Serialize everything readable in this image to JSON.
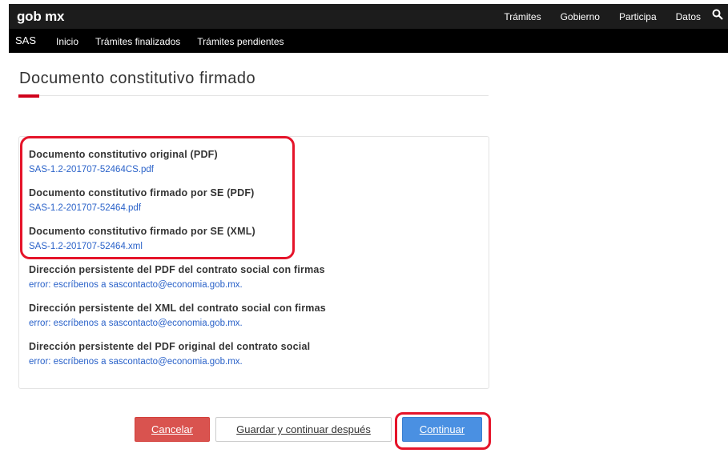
{
  "header": {
    "brand": "gob mx",
    "nav": [
      "Trámites",
      "Gobierno",
      "Participa",
      "Datos"
    ],
    "search_icon": "search-icon"
  },
  "subnav": {
    "app": "SAS",
    "items": [
      "Inicio",
      "Trámites finalizados",
      "Trámites pendientes"
    ]
  },
  "page": {
    "title": "Documento constitutivo firmado"
  },
  "documents": [
    {
      "label": "Documento constitutivo original (PDF)",
      "value": "SAS-1.2-201707-52464CS.pdf"
    },
    {
      "label": "Documento constitutivo firmado por SE (PDF)",
      "value": "SAS-1.2-201707-52464.pdf"
    },
    {
      "label": "Documento constitutivo firmado por SE (XML)",
      "value": "SAS-1.2-201707-52464.xml"
    },
    {
      "label": "Dirección persistente del PDF del contrato social con firmas",
      "value": "error: escríbenos a sascontacto@economia.gob.mx."
    },
    {
      "label": "Dirección persistente del XML del contrato social con firmas",
      "value": "error: escríbenos a sascontacto@economia.gob.mx."
    },
    {
      "label": "Dirección persistente del PDF original del contrato social",
      "value": "error: escríbenos a sascontacto@economia.gob.mx."
    }
  ],
  "actions": {
    "cancel": "Cancelar",
    "save_later": "Guardar y continuar después",
    "continue": "Continuar"
  },
  "colors": {
    "accent_red": "#d0011b",
    "link_blue": "#2a62c9",
    "primary_blue": "#4a90e2",
    "danger": "#d9534f",
    "highlight": "#e5142a"
  }
}
